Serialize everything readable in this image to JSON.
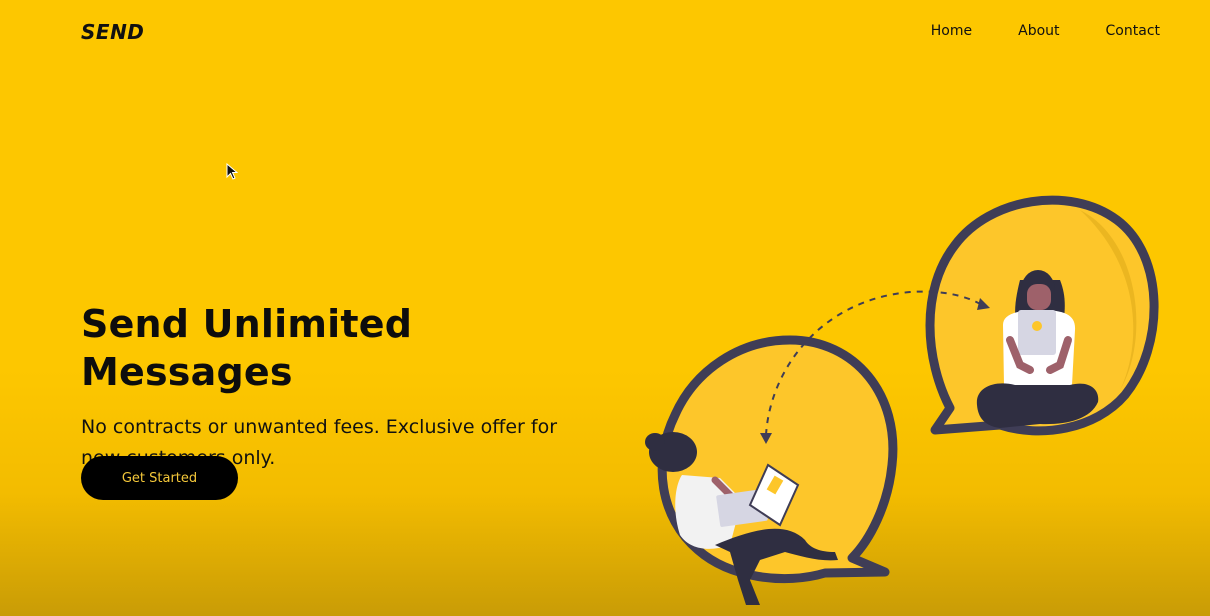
{
  "brand": {
    "logo": "SEND"
  },
  "nav": {
    "items": [
      {
        "label": "Home"
      },
      {
        "label": "About"
      },
      {
        "label": "Contact"
      }
    ]
  },
  "hero": {
    "title": "Send Unlimited Messages",
    "subtitle": "No contracts or unwanted fees. Exclusive offer for new customers only.",
    "cta_label": "Get Started"
  },
  "colors": {
    "background": "#fdc700",
    "button_bg": "#000000",
    "button_text": "#f5c83a",
    "bubble_fill": "#fdc62a",
    "bubble_stroke": "#3f3d56"
  },
  "icons": {
    "cursor": "mouse-pointer-icon",
    "illustration": "messaging-people-illustration"
  }
}
